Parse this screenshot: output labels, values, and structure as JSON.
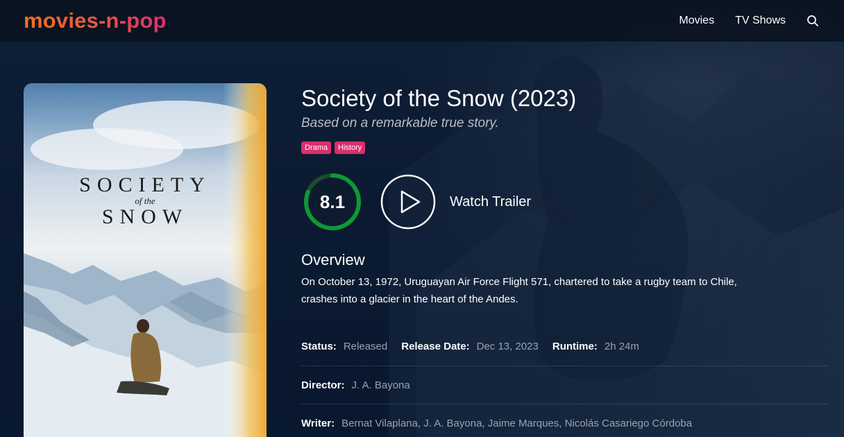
{
  "site": {
    "logo": "movies-n-pop"
  },
  "nav": {
    "items": [
      "Movies",
      "TV Shows"
    ]
  },
  "poster": {
    "line1": "SOCIETY",
    "line2": "of the",
    "line3": "SNOW"
  },
  "movie": {
    "title": "Society of the Snow (2023)",
    "tagline": "Based on a remarkable true story.",
    "genres": [
      "Drama",
      "History"
    ],
    "rating": "8.1",
    "rating_fraction": 0.81,
    "trailer_label": "Watch Trailer",
    "overview_heading": "Overview",
    "overview": "On October 13, 1972, Uruguayan Air Force Flight 571, chartered to take a rugby team to Chile, crashes into a glacier in the heart of the Andes.",
    "status_label": "Status:",
    "status": "Released",
    "release_label": "Release Date:",
    "release_date": "Dec 13, 2023",
    "runtime_label": "Runtime:",
    "runtime": "2h 24m",
    "director_label": "Director:",
    "director": "J. A. Bayona",
    "writer_label": "Writer:",
    "writer": "Bernat Vilaplana, J. A. Bayona, Jaime Marques, Nicolás Casariego Córdoba"
  },
  "colors": {
    "accent": "#da2f6c",
    "logo_start": "#f26f1e",
    "rating_ring": "#21d07a",
    "rating_track": "#1b4d2e"
  },
  "icons": {
    "search": "search-icon",
    "play": "play-icon"
  }
}
